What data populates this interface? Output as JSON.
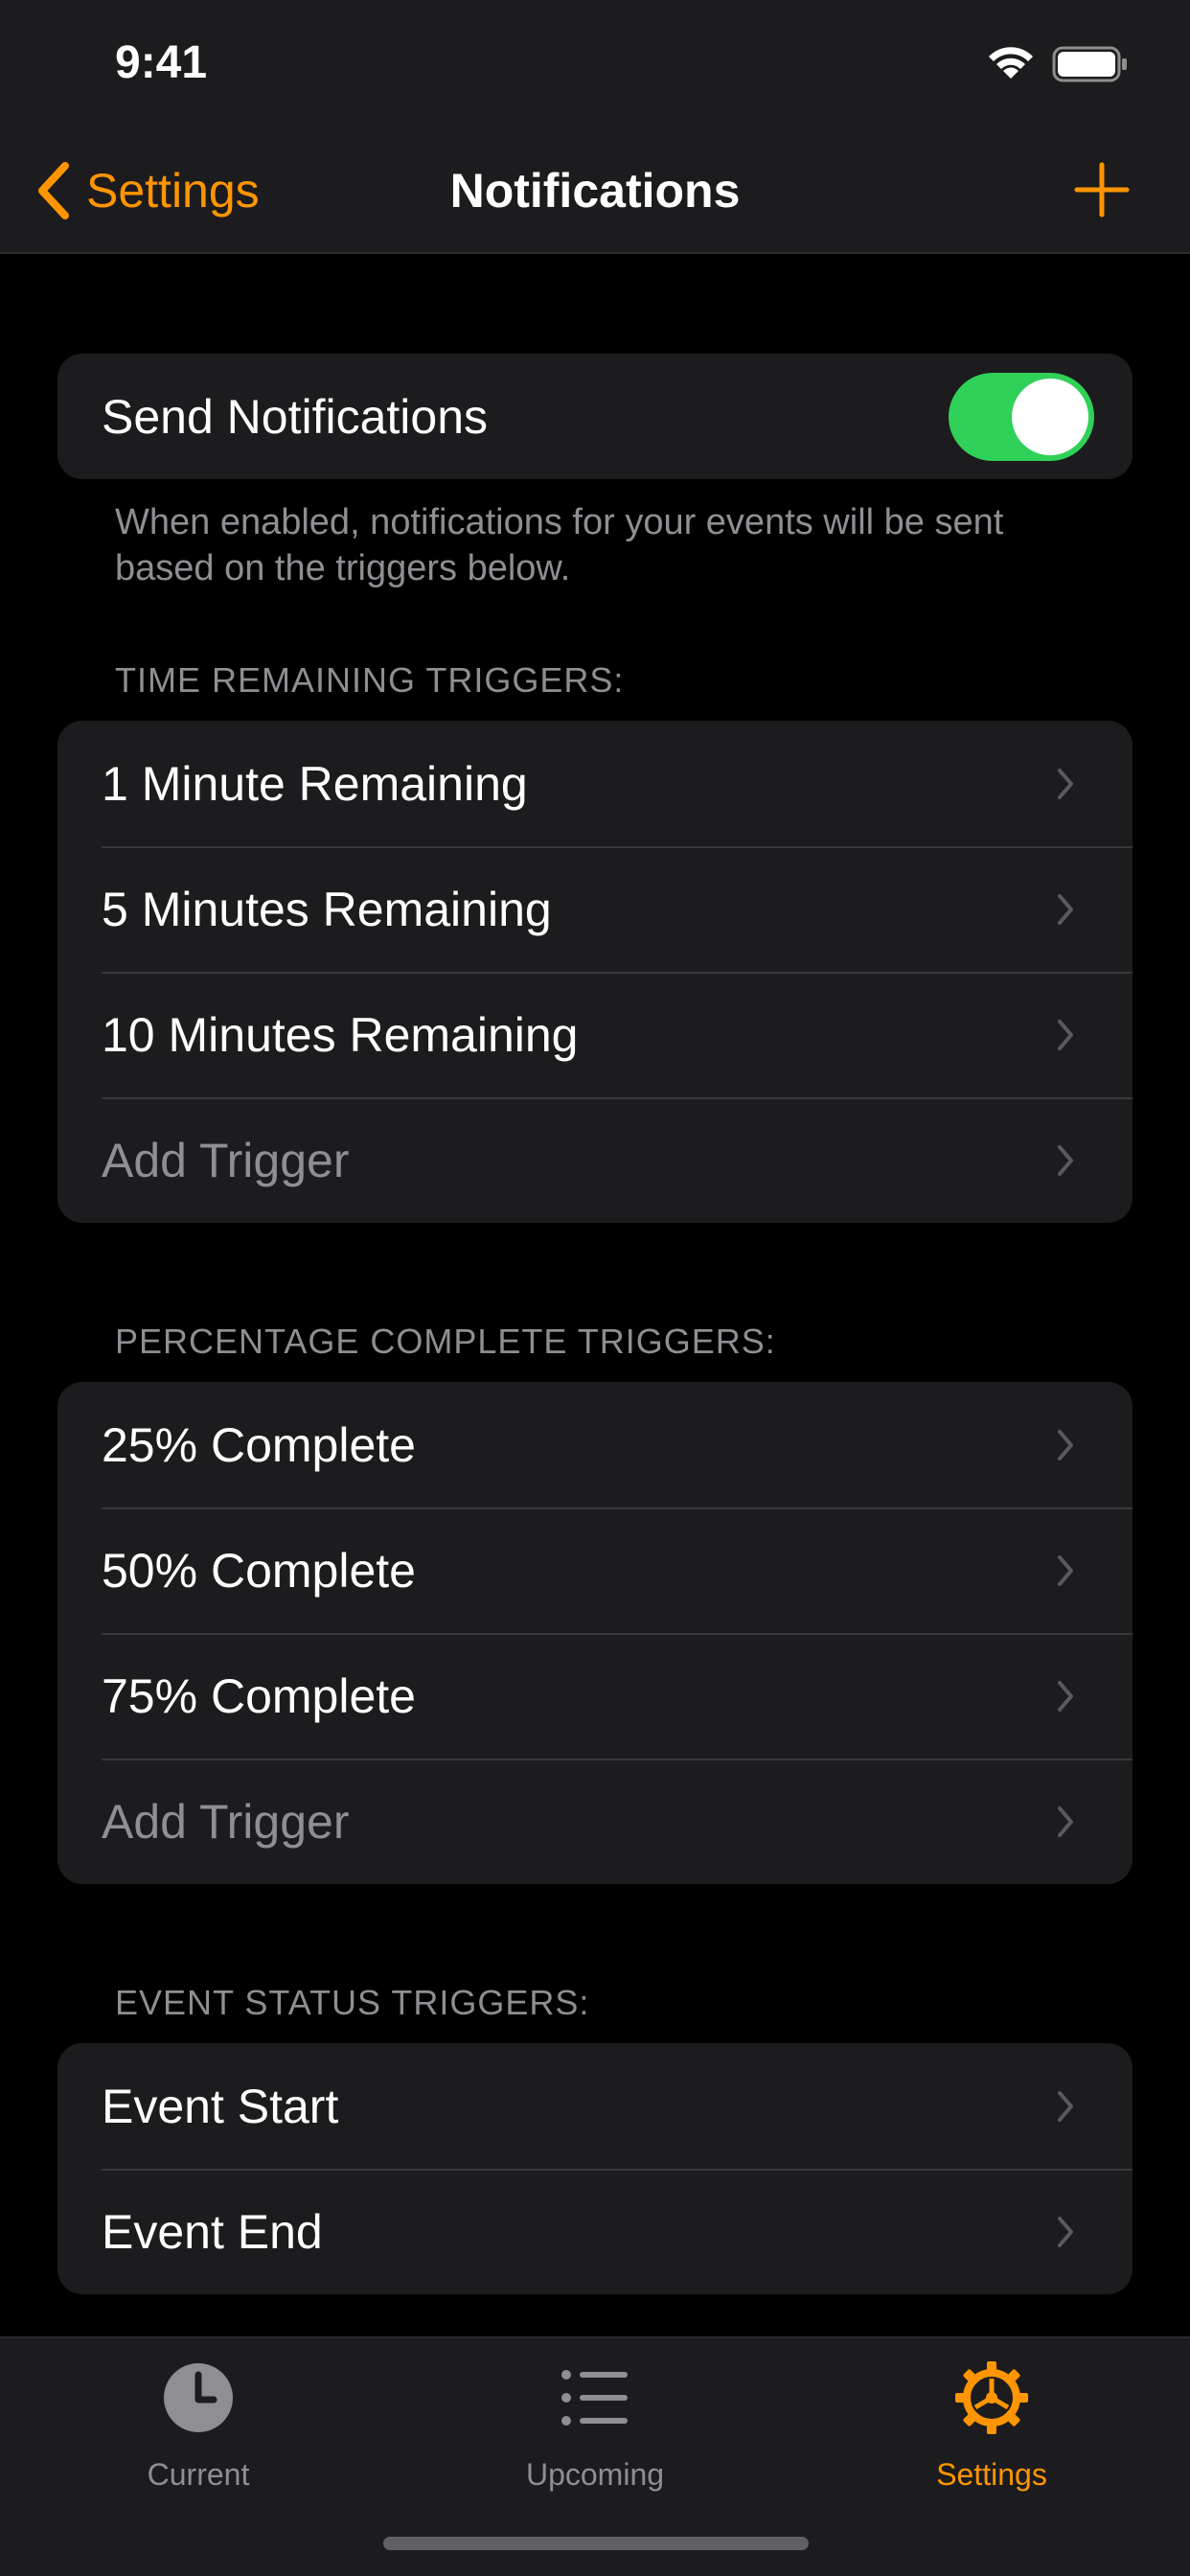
{
  "status_bar": {
    "time": "9:41"
  },
  "nav": {
    "back_label": "Settings",
    "title": "Notifications"
  },
  "send_notifications": {
    "label": "Send Notifications",
    "enabled": true,
    "footnote": "When enabled, notifications for your events will be sent based on the triggers below."
  },
  "sections": {
    "time_remaining": {
      "header": "TIME REMAINING TRIGGERS:",
      "items": [
        "1 Minute Remaining",
        "5 Minutes Remaining",
        "10 Minutes Remaining"
      ],
      "add_label": "Add Trigger"
    },
    "percentage": {
      "header": "PERCENTAGE COMPLETE TRIGGERS:",
      "items": [
        "25% Complete",
        "50% Complete",
        "75% Complete"
      ],
      "add_label": "Add Trigger"
    },
    "event_status": {
      "header": "EVENT STATUS TRIGGERS:",
      "items": [
        "Event Start",
        "Event End"
      ]
    }
  },
  "tabs": [
    {
      "label": "Current",
      "icon": "clock-icon",
      "active": false
    },
    {
      "label": "Upcoming",
      "icon": "list-icon",
      "active": false
    },
    {
      "label": "Settings",
      "icon": "gear-icon",
      "active": true
    }
  ],
  "colors": {
    "accent": "#ff9500",
    "toggle_on": "#30d158",
    "background": "#000000",
    "card": "#1c1c1e",
    "secondary_text": "#8e8e93"
  }
}
